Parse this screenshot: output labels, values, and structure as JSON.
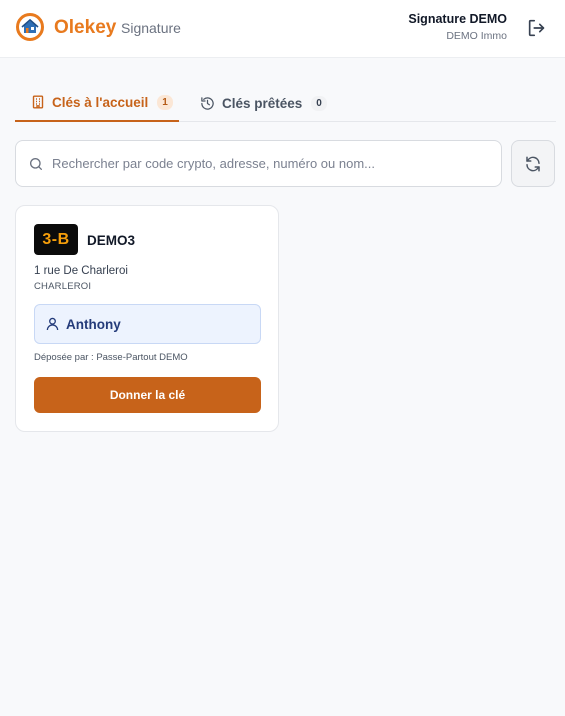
{
  "header": {
    "brand": "Olekey",
    "product": "Signature",
    "user_name": "Signature DEMO",
    "user_org": "DEMO Immo",
    "logo_icon": "house-logo-icon",
    "logout_icon": "logout-icon"
  },
  "tabs": [
    {
      "label": "Clés à l'accueil",
      "count": "1",
      "icon": "building-icon",
      "active": true
    },
    {
      "label": "Clés prêtées",
      "count": "0",
      "icon": "history-icon",
      "active": false
    }
  ],
  "search": {
    "placeholder": "Rechercher par code crypto, adresse, numéro ou nom..."
  },
  "keys": [
    {
      "code": "3-B",
      "name": "DEMO3",
      "address": "1 rue De Charleroi",
      "city": "CHARLEROI",
      "holder": "Anthony",
      "deposited_by": "Déposée par : Passe-Partout DEMO",
      "action_label": "Donner la clé"
    }
  ],
  "colors": {
    "accent": "#c7631a",
    "brand": "#e87a1e",
    "holder_bg": "#edf3fe",
    "holder_text": "#243b7a"
  }
}
